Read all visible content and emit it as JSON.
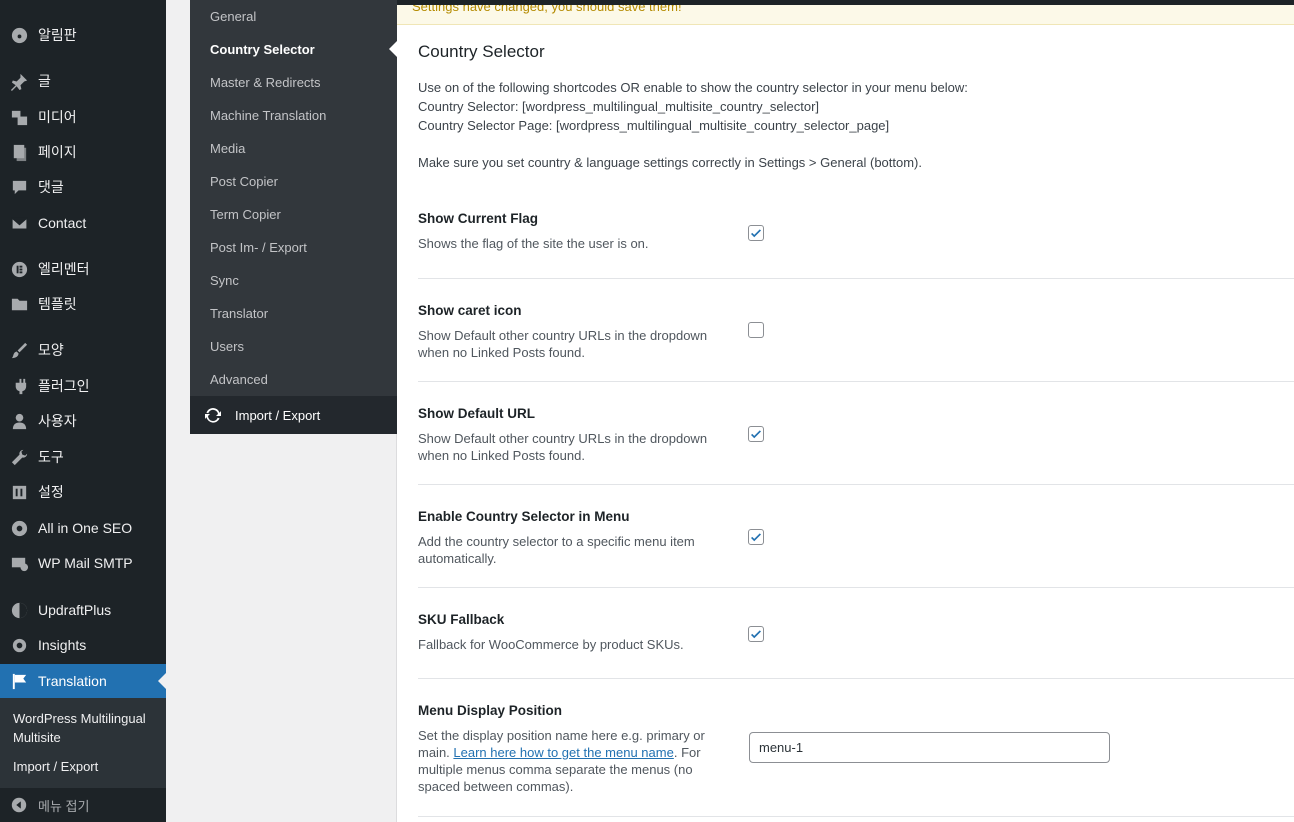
{
  "admin_menu": {
    "items": [
      {
        "label": "알림판",
        "icon": "dashboard-icon"
      },
      {
        "label": "글",
        "icon": "pin-icon"
      },
      {
        "label": "미디어",
        "icon": "media-icon"
      },
      {
        "label": "페이지",
        "icon": "page-icon"
      },
      {
        "label": "댓글",
        "icon": "comment-icon"
      },
      {
        "label": "Contact",
        "icon": "mail-icon"
      },
      {
        "label": "엘리멘터",
        "icon": "elementor-icon"
      },
      {
        "label": "템플릿",
        "icon": "folder-icon"
      },
      {
        "label": "모양",
        "icon": "brush-icon"
      },
      {
        "label": "플러그인",
        "icon": "plug-icon"
      },
      {
        "label": "사용자",
        "icon": "user-icon"
      },
      {
        "label": "도구",
        "icon": "wrench-icon"
      },
      {
        "label": "설정",
        "icon": "settings-icon"
      },
      {
        "label": "All in One SEO",
        "icon": "aioseo-icon"
      },
      {
        "label": "WP Mail SMTP",
        "icon": "mail-smtp-icon"
      },
      {
        "label": "UpdraftPlus",
        "icon": "updraft-icon"
      },
      {
        "label": "Insights",
        "icon": "insights-icon"
      },
      {
        "label": "Translation",
        "icon": "flag-icon"
      }
    ],
    "submenu": {
      "multisite": "WordPress Multilingual Multisite",
      "import_export": "Import / Export"
    },
    "collapse_label": "메뉴 접기"
  },
  "plugin_nav": {
    "items": [
      "General",
      "Country Selector",
      "Master & Redirects",
      "Machine Translation",
      "Media",
      "Post Copier",
      "Term Copier",
      "Post Im- / Export",
      "Sync",
      "Translator",
      "Users",
      "Advanced"
    ],
    "active": "Country Selector",
    "footer_label": "Import / Export"
  },
  "notice": "Settings have changed, you should save them!",
  "page": {
    "title": "Country Selector",
    "intro": [
      "Use on of the following shortcodes OR enable to show the country selector in your menu below:",
      "Country Selector: [wordpress_multilingual_multisite_country_selector]",
      "Country Selector Page: [wordpress_multilingual_multisite_country_selector_page]",
      "Make sure you set country & language settings correctly in Settings > General (bottom)."
    ]
  },
  "options": [
    {
      "label": "Show Current Flag",
      "desc": "Shows the flag of the site the user is on.",
      "checked": true
    },
    {
      "label": "Show caret icon",
      "desc": "Show Default other country URLs in the dropdown when no Linked Posts found.",
      "checked": false
    },
    {
      "label": "Show Default URL",
      "desc": "Show Default other country URLs in the dropdown when no Linked Posts found.",
      "checked": true
    },
    {
      "label": "Enable Country Selector in Menu",
      "desc": "Add the country selector to a specific menu item automatically.",
      "checked": true
    },
    {
      "label": "SKU Fallback",
      "desc": "Fallback for WooCommerce by product SKUs.",
      "checked": true
    }
  ],
  "menu_position": {
    "label": "Menu Display Position",
    "desc_before": "Set the display position name here e.g. primary or main. ",
    "link": "Learn here how to get the menu name",
    "desc_after": ". For multiple menus comma separate the menus (no spaced between commas).",
    "value": "menu-1"
  },
  "colors": {
    "accent": "#2271b1",
    "sidebar": "#1d2327",
    "plugin_nav": "#32373c"
  }
}
